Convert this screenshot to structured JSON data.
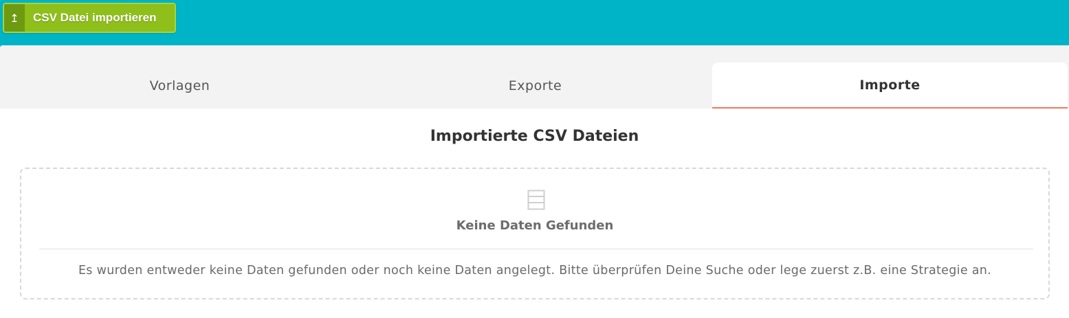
{
  "toolbar": {
    "import_button_label": "CSV Datei importieren",
    "import_button_icon": "upload-icon"
  },
  "tabs": [
    {
      "label": "Vorlagen",
      "active": false
    },
    {
      "label": "Exporte",
      "active": false
    },
    {
      "label": "Importe",
      "active": true
    }
  ],
  "main": {
    "section_title": "Importierte CSV Dateien",
    "empty_state": {
      "icon": "table-icon",
      "title": "Keine Daten Gefunden",
      "message": "Es wurden entweder keine Daten gefunden oder noch keine Daten angelegt. Bitte überprüfen Deine Suche oder lege zuerst z.B. eine Strategie an."
    }
  },
  "colors": {
    "header_background": "#00b4c8",
    "button_green": "#8fbf1b",
    "active_tab_accent": "#f2775a"
  }
}
